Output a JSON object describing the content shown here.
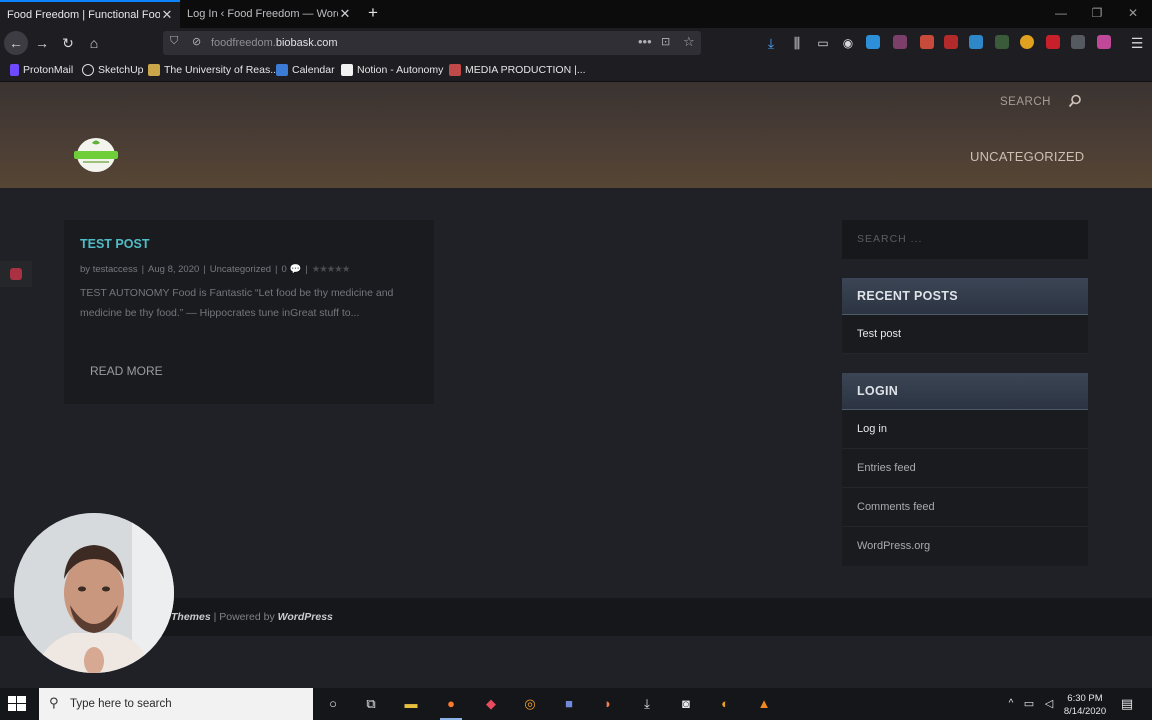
{
  "browser": {
    "tabs": [
      {
        "title": "Food Freedom | Functional Food So",
        "active": true
      },
      {
        "title": "Log In ‹ Food Freedom — WordPre",
        "active": false
      }
    ],
    "url_prefix": "foodfreedom.",
    "url_domain": "biobask.com",
    "bookmarks": [
      "ProtonMail",
      "SketchUp",
      "The University of Reas...",
      "Calendar",
      "Notion - Autonomy",
      "MEDIA PRODUCTION |..."
    ]
  },
  "site": {
    "header_search": "SEARCH",
    "nav_item": "UNCATEGORIZED",
    "logo_text": "Food Freedom",
    "post": {
      "title": "TEST POST",
      "author_prefix": "by",
      "author": "testaccess",
      "date": "Aug 8, 2020",
      "category": "Uncategorized",
      "comments": "0",
      "excerpt": "TEST AUTONOMY Food is Fantastic “Let food be thy medicine and medicine be thy food.” — Hippocrates tune inGreat stuff to...",
      "read_more": "READ MORE"
    },
    "sidebar": {
      "search_placeholder": "SEARCH ...",
      "recent_posts_title": "RECENT POSTS",
      "recent_posts": [
        "Test post"
      ],
      "login_title": "LOGIN",
      "login_links": [
        "Log in",
        "Entries feed",
        "Comments feed",
        "WordPress.org"
      ]
    },
    "footer": {
      "themes": "Themes",
      "powered_by": " | Powered by ",
      "wordpress": "WordPress"
    }
  },
  "taskbar": {
    "search_placeholder": "Type here to search",
    "time": "6:30 PM",
    "date": "8/14/2020"
  }
}
